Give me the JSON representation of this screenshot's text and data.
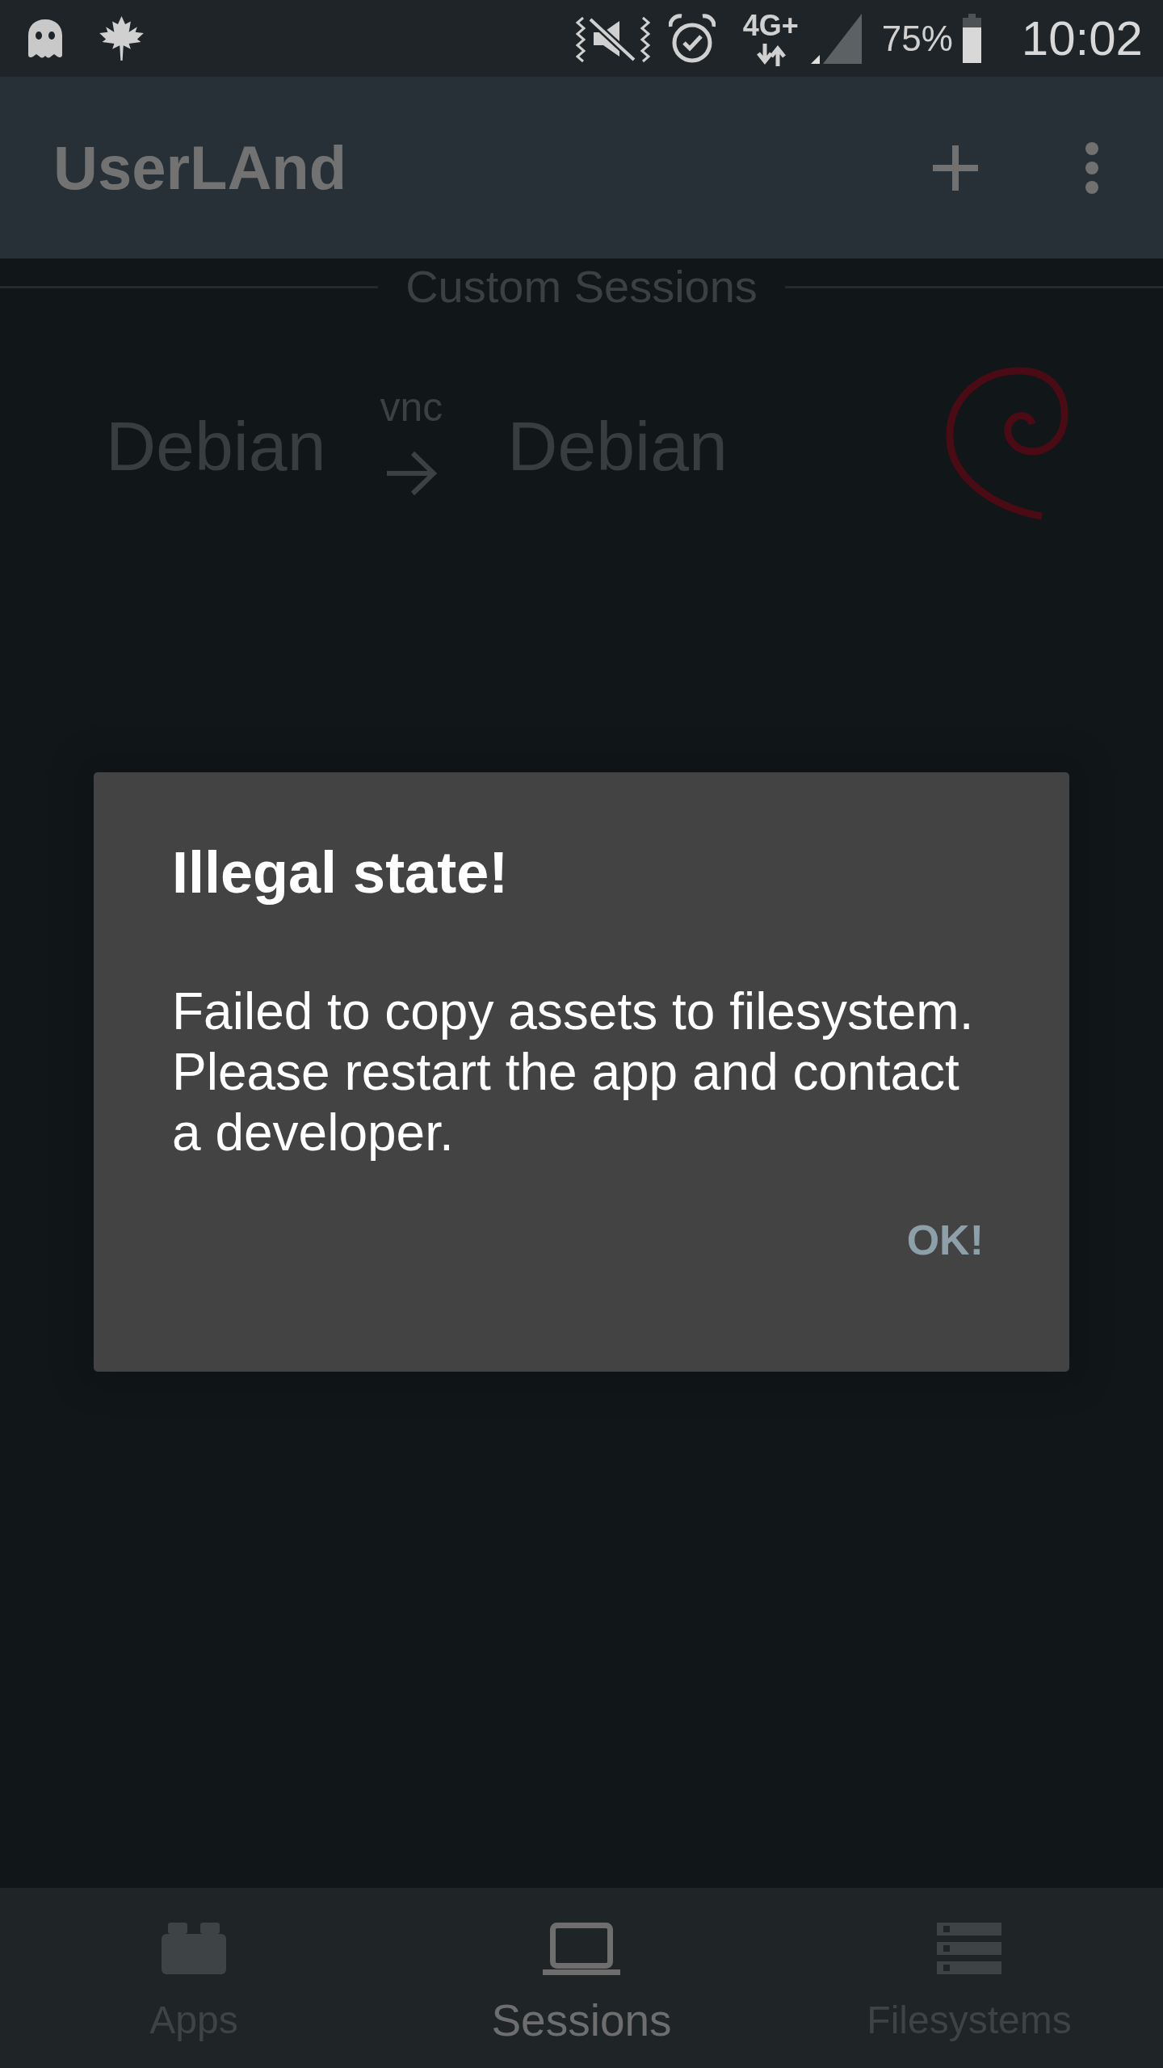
{
  "status_bar": {
    "network": "4G+",
    "battery": "75%",
    "time": "10:02"
  },
  "app_bar": {
    "title": "UserLAnd"
  },
  "section_header": "Custom Sessions",
  "sessions": [
    {
      "name": "Debian",
      "service": "vnc",
      "filesystem": "Debian"
    }
  ],
  "dialog": {
    "title": "Illegal state!",
    "message": "Failed to copy assets to filesystem. Please restart the app and contact a developer.",
    "buttons": [
      "OK!"
    ]
  },
  "bottom_nav": [
    {
      "label": "Apps",
      "selected": false
    },
    {
      "label": "Sessions",
      "selected": true
    },
    {
      "label": "Filesystems",
      "selected": false
    }
  ]
}
